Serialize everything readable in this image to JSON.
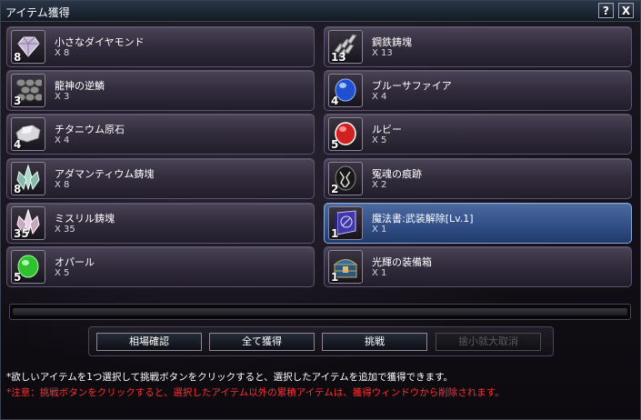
{
  "window": {
    "title": "アイテム獲得",
    "help_label": "?",
    "close_label": "X"
  },
  "items_left": [
    {
      "name": "小さなダイヤモンド",
      "qty": "X 8",
      "count": "8",
      "icon": "diamond-icon"
    },
    {
      "name": "龍神の逆鱗",
      "qty": "X 3",
      "count": "3",
      "icon": "dragon-scale-icon"
    },
    {
      "name": "チタニウム原石",
      "qty": "X 4",
      "count": "4",
      "icon": "titanium-ore-icon"
    },
    {
      "name": "アダマンティウム鋳塊",
      "qty": "X 8",
      "count": "8",
      "icon": "adamantium-crystal-icon"
    },
    {
      "name": "ミスリル鋳塊",
      "qty": "X 35",
      "count": "35",
      "icon": "mithril-crystal-icon"
    },
    {
      "name": "オパール",
      "qty": "X 5",
      "count": "5",
      "icon": "opal-gem-icon"
    }
  ],
  "items_right": [
    {
      "name": "鋼鉄鋳塊",
      "qty": "X 13",
      "count": "13",
      "icon": "steel-ingot-icon"
    },
    {
      "name": "ブルーサファイア",
      "qty": "X 4",
      "count": "4",
      "icon": "blue-sapphire-icon"
    },
    {
      "name": "ルビー",
      "qty": "X 5",
      "count": "5",
      "icon": "ruby-icon"
    },
    {
      "name": "冤魂の痕跡",
      "qty": "X 2",
      "count": "2",
      "icon": "spirit-trace-icon"
    },
    {
      "name": "魔法書:武装解除[Lv.1]",
      "qty": "X 1",
      "count": "1",
      "icon": "spellbook-icon"
    },
    {
      "name": "光輝の装備箱",
      "qty": "X 1",
      "count": "1",
      "icon": "treasure-chest-icon"
    }
  ],
  "selected_item": "魔法書:武装解除[Lv.1]",
  "buttons": {
    "market_check": "相場確認",
    "get_all": "全て獲得",
    "challenge": "挑戦",
    "cancel": "捨小就大取消"
  },
  "notes": {
    "line1": "*欲しいアイテムを1つ選択して挑戦ボタンをクリックすると、選択したアイテムを追加で獲得できます。",
    "line2": "*注意：挑戦ボタンをクリックすると、選択したアイテム以外の累積アイテムは、獲得ウィンドウから削除されます。"
  },
  "colors": {
    "selected_bg": "#34528a",
    "warning_text": "#ff3030"
  }
}
